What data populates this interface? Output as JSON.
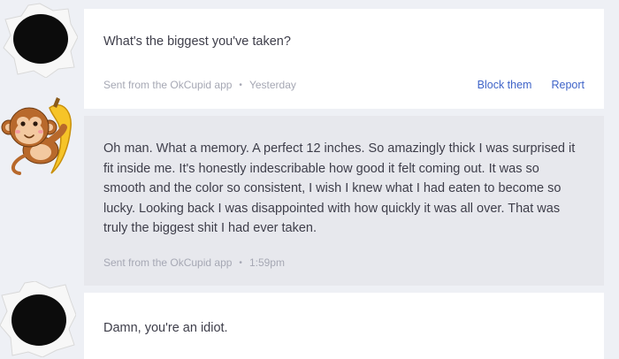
{
  "messages": [
    {
      "text": "What's the biggest you've taken?",
      "source": "Sent from the OkCupid app",
      "time": "Yesterday",
      "actions": {
        "block": "Block them",
        "report": "Report"
      }
    },
    {
      "text": "Oh man. What a memory. A perfect 12 inches. So amazingly thick I was surprised it fit inside me. It's honestly indescribable how good it felt coming out. It was so smooth and the color so consistent, I wish I knew what I had eaten to become so lucky. Looking back I was disappointed with how quickly it was all over. That was truly the biggest shit I had ever taken.",
      "source": "Sent from the OkCupid app",
      "time": "1:59pm"
    },
    {
      "text": "Damn, you're an idiot."
    }
  ],
  "separator": "•",
  "colors": {
    "page_bg": "#eef0f5",
    "their_bubble": "#ffffff",
    "my_bubble": "#e7e8ed",
    "link": "#3f64c8",
    "meta_text": "#a6a8b4"
  },
  "icons": {
    "sender_avatar": "censored-black-avatar",
    "my_avatar": "monkey-banana-avatar"
  }
}
